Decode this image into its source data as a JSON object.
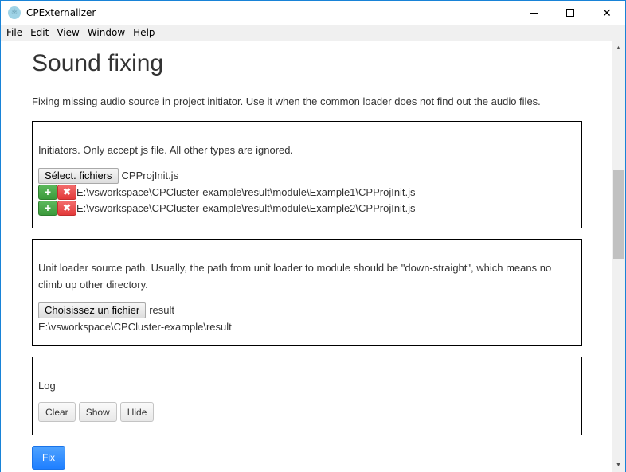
{
  "window": {
    "title": "CPExternalizer",
    "app_icon": "react-atom-icon",
    "controls": [
      "minimize",
      "maximize",
      "close"
    ]
  },
  "menubar": {
    "items": [
      "File",
      "Edit",
      "View",
      "Window",
      "Help"
    ]
  },
  "page": {
    "title": "Sound fixing",
    "description": "Fixing missing audio source in project initiator. Use it when the common loader does not find out the audio files."
  },
  "initiators": {
    "label": "Initiators. Only accept js file. All other types are ignored.",
    "button_label": "Sélect. fichiers",
    "selected_file": "CPProjInit.js",
    "files": [
      {
        "path": "E:\\vsworkspace\\CPCluster-example\\result\\module\\Example1\\CPProjInit.js"
      },
      {
        "path": "E:\\vsworkspace\\CPCluster-example\\result\\module\\Example2\\CPProjInit.js"
      }
    ],
    "add_icon": "+",
    "remove_icon": "✖"
  },
  "unit_loader": {
    "label": "Unit loader source path. Usually, the path from unit loader to module should be \"down-straight\", which means no climb up other directory.",
    "button_label": "Choisissez un fichier",
    "selected_file": "result",
    "path": "E:\\vsworkspace\\CPCluster-example\\result"
  },
  "log": {
    "label": "Log",
    "buttons": {
      "clear": "Clear",
      "show": "Show",
      "hide": "Hide"
    }
  },
  "actions": {
    "fix_label": "Fix"
  },
  "colors": {
    "window_border": "#1883d7",
    "add_button": "#4cae4c",
    "remove_button": "#ea4b4b",
    "fix_button": "#2e8bff"
  }
}
